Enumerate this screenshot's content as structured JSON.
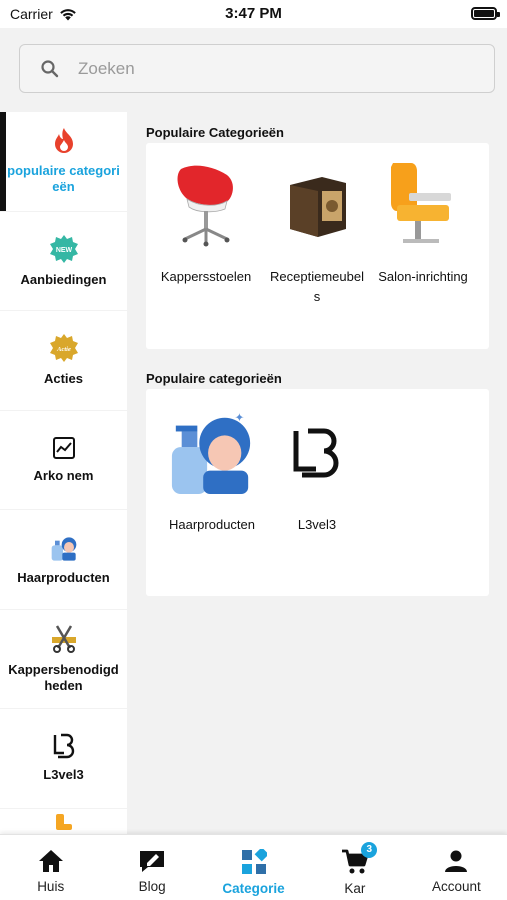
{
  "status": {
    "carrier": "Carrier",
    "time": "3:47 PM"
  },
  "search": {
    "placeholder": "Zoeken"
  },
  "accent_color": "#1aa3dd",
  "sidebar": {
    "items": [
      {
        "label": "populaire categorieën",
        "icon": "flame-icon",
        "active": true
      },
      {
        "label": "Aanbiedingen",
        "icon": "new-badge-icon"
      },
      {
        "label": "Acties",
        "icon": "actie-badge-icon"
      },
      {
        "label": "Arko nem",
        "icon": "image-placeholder-icon"
      },
      {
        "label": "Haarproducten",
        "icon": "hair-products-icon"
      },
      {
        "label": "Kappersbenodigdheden",
        "icon": "scissors-comb-icon"
      },
      {
        "label": "L3vel3",
        "icon": "l3vel3-logo-icon"
      },
      {
        "label": "",
        "icon": "salon-chair-icon"
      }
    ]
  },
  "sections": [
    {
      "title": "Populaire Categorieën",
      "tiles": [
        {
          "label": "Kappersstoelen",
          "icon": "red-barber-chair-image"
        },
        {
          "label": "Receptiemeubels",
          "icon": "reception-desk-image"
        },
        {
          "label": "Salon-inrichting",
          "icon": "orange-salon-chair-image"
        }
      ]
    },
    {
      "title": "Populaire categorieën",
      "tiles": [
        {
          "label": "Haarproducten",
          "icon": "hair-products-image"
        },
        {
          "label": "L3vel3",
          "icon": "l3vel3-logo-image"
        }
      ]
    }
  ],
  "bottom_nav": [
    {
      "label": "Huis",
      "icon": "home-icon"
    },
    {
      "label": "Blog",
      "icon": "blog-icon"
    },
    {
      "label": "Categorie",
      "icon": "category-icon",
      "active": true
    },
    {
      "label": "Kar",
      "icon": "cart-icon",
      "badge": "3"
    },
    {
      "label": "Account",
      "icon": "account-icon"
    }
  ]
}
